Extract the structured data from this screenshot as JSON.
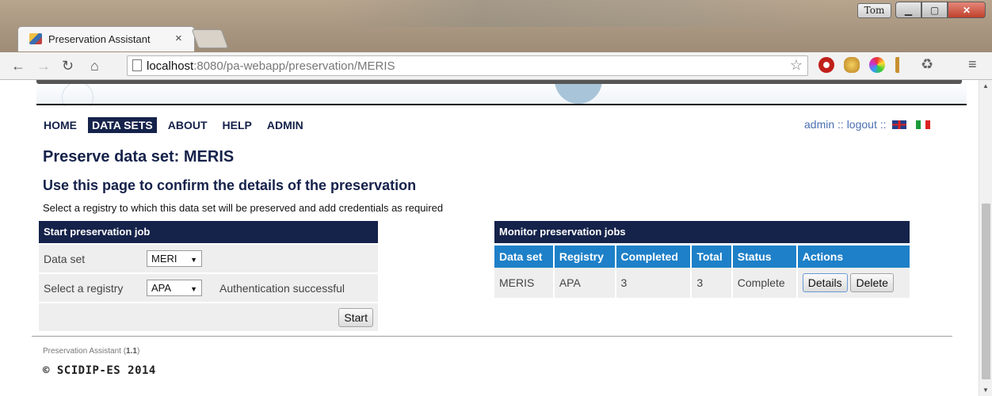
{
  "browser": {
    "tab_title": "Preservation Assistant",
    "tab_close": "×",
    "user_button": "Tom",
    "url_host": "localhost",
    "url_path": ":8080/pa-webapp/preservation/MERIS"
  },
  "nav": {
    "items": [
      "HOME",
      "DATA SETS",
      "ABOUT",
      "HELP",
      "ADMIN"
    ],
    "active": "DATA SETS",
    "user_links": "admin :: logout ::"
  },
  "page": {
    "title": "Preserve data set: MERIS",
    "subtitle": "Use this page to confirm the details of the preservation",
    "intro": "Select a registry to which this data set will be preserved and add credentials as required"
  },
  "start_job": {
    "heading": "Start preservation job",
    "dataset_label": "Data set",
    "dataset_value": "MERI",
    "registry_label": "Select a registry",
    "registry_value": "APA",
    "auth_status": "Authentication successful",
    "start_button": "Start"
  },
  "monitor": {
    "heading": "Monitor preservation jobs",
    "columns": [
      "Data set",
      "Registry",
      "Completed",
      "Total",
      "Status",
      "Actions"
    ],
    "rows": [
      {
        "dataset": "MERIS",
        "registry": "APA",
        "completed": "3",
        "total": "3",
        "status": "Complete",
        "details": "Details",
        "delete": "Delete"
      }
    ]
  },
  "footer": {
    "app_name": "Preservation Assistant (",
    "version": "1.1",
    "version_close": ")",
    "copyright": "© SCIDIP-ES 2014"
  }
}
